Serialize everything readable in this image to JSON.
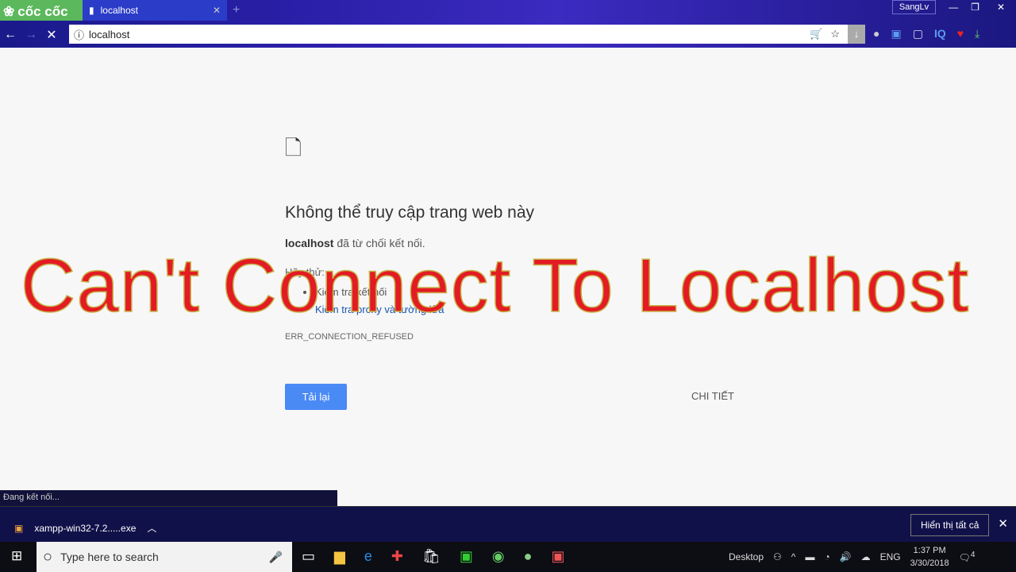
{
  "browser": {
    "brand": "cốc cốc",
    "tab_title": "localhost",
    "new_tab": "+",
    "user": "SangLv",
    "url": "localhost"
  },
  "page": {
    "title": "Không thể truy cập trang web này",
    "host": "localhost",
    "message": " đã từ chối kết nối.",
    "try_label": "Hãy thử:",
    "suggestions": [
      "Kiểm tra kết nối",
      "Kiểm tra proxy và tường lửa"
    ],
    "error_code": "ERR_CONNECTION_REFUSED",
    "reload": "Tải lại",
    "details": "CHI TIẾT"
  },
  "overlay": "Can't Connect To Localhost",
  "status": "Đang kết nối...",
  "downloads": {
    "file": "xampp-win32-7.2.....exe",
    "show_all": "Hiển thị tất cả"
  },
  "taskbar": {
    "search_placeholder": "Type here to search",
    "desktop": "Desktop",
    "lang": "ENG",
    "time": "1:37 PM",
    "date": "3/30/2018",
    "notifications": "4"
  },
  "colors": {
    "overlay": "#e31b23",
    "reload": "#4a8af4",
    "brand": "#5cb85c"
  }
}
